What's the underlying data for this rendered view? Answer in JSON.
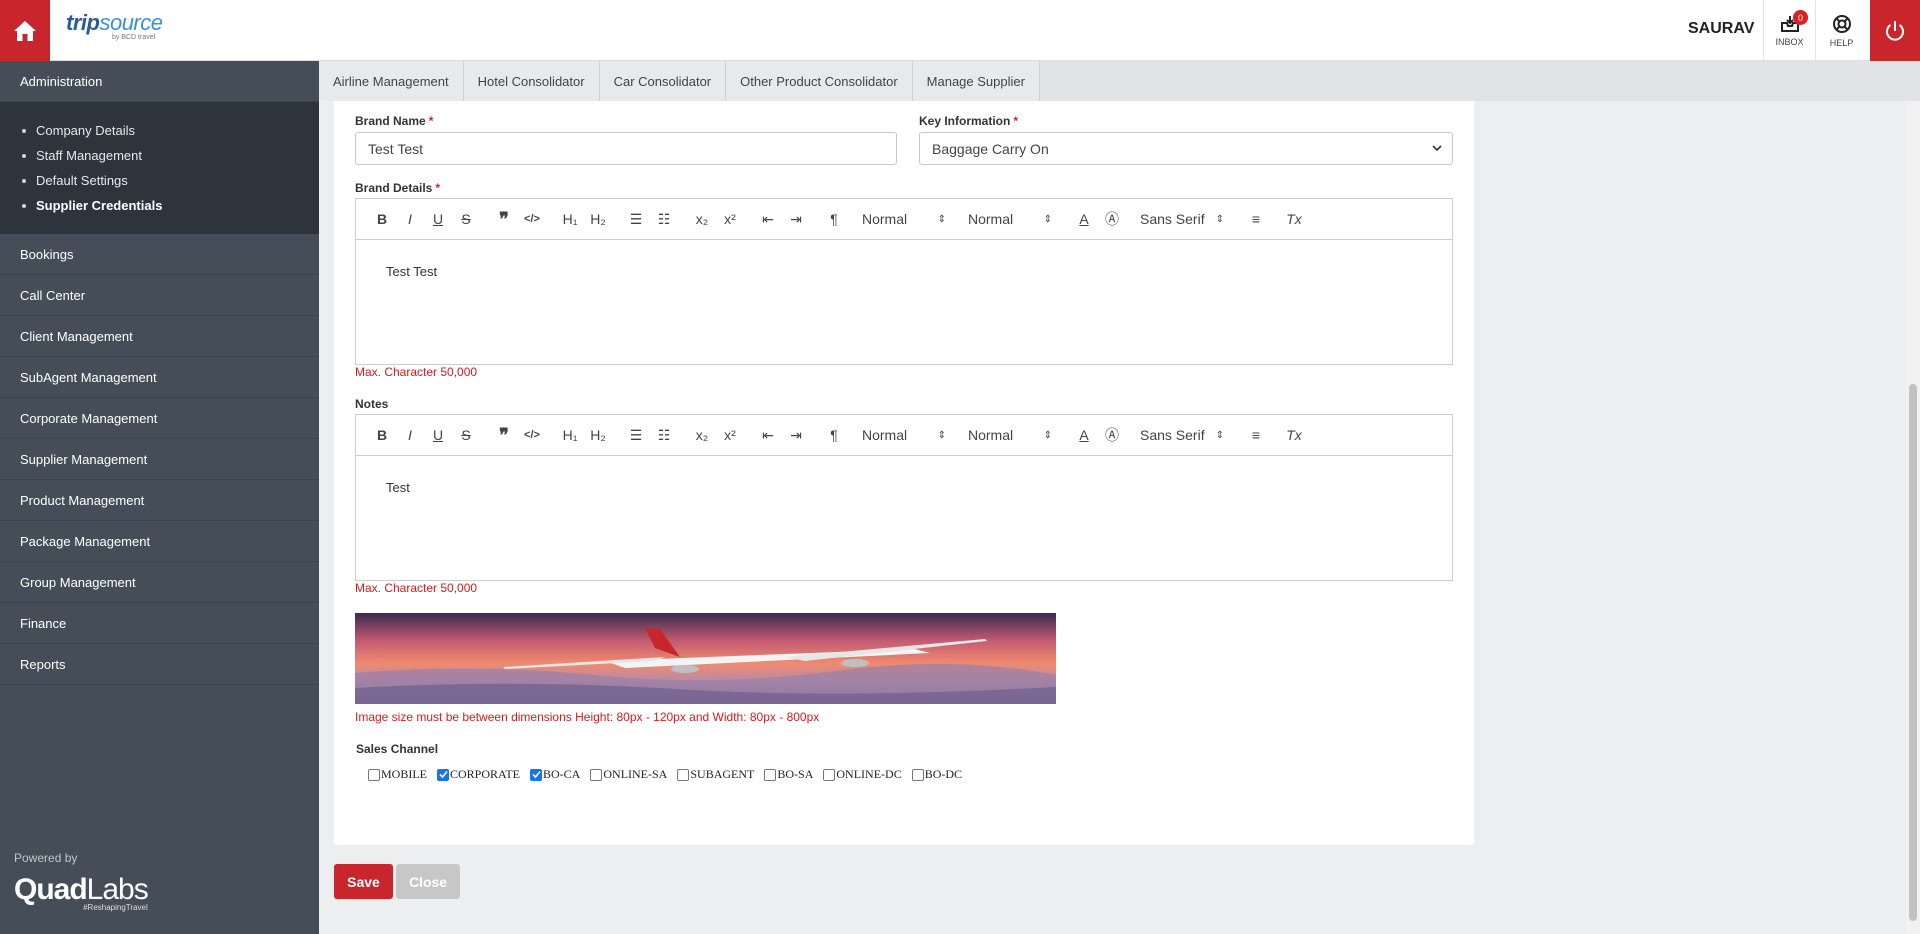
{
  "app": {
    "logo_main": "trip",
    "logo_main2": "source",
    "logo_sub": "by BCD travel",
    "user_name": "SAURAV",
    "inbox_label": "INBOX",
    "inbox_count": "0",
    "help_label": "HELP"
  },
  "sidebar": {
    "section": "Administration",
    "subitems": [
      "Company Details",
      "Staff Management",
      "Default Settings",
      "Supplier Credentials"
    ],
    "items": [
      "Bookings",
      "Call Center",
      "Client Management",
      "SubAgent Management",
      "Corporate Management",
      "Supplier Management",
      "Product Management",
      "Package Management",
      "Group Management",
      "Finance",
      "Reports"
    ],
    "powered_by": "Powered by",
    "brand_a": "Quad",
    "brand_b": "Labs",
    "brand_tag": "#ReshapingTravel"
  },
  "tabs": [
    "Airline Management",
    "Hotel Consolidator",
    "Car Consolidator",
    "Other Product Consolidator",
    "Manage Supplier"
  ],
  "form": {
    "brand_name_label": "Brand Name",
    "brand_name_value": "Test Test",
    "key_info_label": "Key Information",
    "key_info_value": "Baggage Carry On",
    "brand_details_label": "Brand Details",
    "brand_details_text": "Test Test",
    "notes_label": "Notes",
    "notes_text": "Test",
    "max_char": "Max. Character 50,000",
    "image_hint": "Image size must be between dimensions Height: 80px - 120px and Width: 80px - 800px",
    "sales_channel_label": "Sales Channel",
    "channels": [
      {
        "label": "MOBILE",
        "checked": false
      },
      {
        "label": "CORPORATE",
        "checked": true
      },
      {
        "label": "BO-CA",
        "checked": true
      },
      {
        "label": "ONLINE-SA",
        "checked": false
      },
      {
        "label": "SUBAGENT",
        "checked": false
      },
      {
        "label": "BO-SA",
        "checked": false
      },
      {
        "label": "ONLINE-DC",
        "checked": false
      },
      {
        "label": "BO-DC",
        "checked": false
      }
    ]
  },
  "toolbar": {
    "header_select": "Normal",
    "size_select": "Normal",
    "font_select": "Sans Serif"
  },
  "buttons": {
    "save": "Save",
    "close": "Close"
  }
}
